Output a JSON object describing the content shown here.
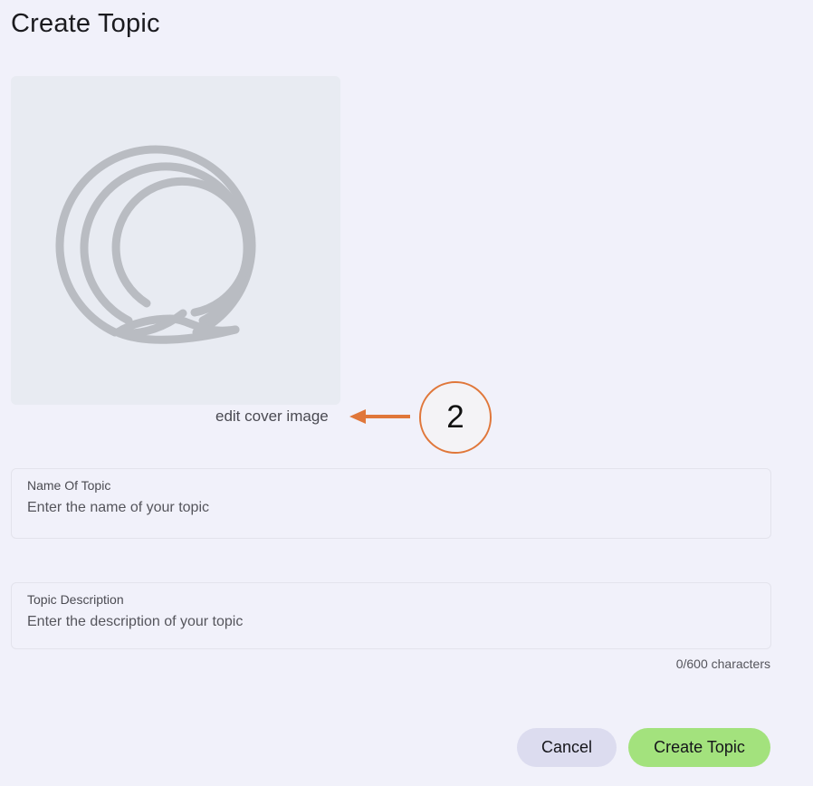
{
  "page": {
    "title": "Create Topic"
  },
  "cover": {
    "edit_label": "edit cover image",
    "placeholder_icon": "logo-ring-icon"
  },
  "annotation": {
    "number": "2",
    "color": "#e0773a"
  },
  "form": {
    "name_field": {
      "label": "Name Of Topic",
      "placeholder": "Enter the name of your topic",
      "value": ""
    },
    "description_field": {
      "label": "Topic Description",
      "placeholder": "Enter the description of your topic",
      "value": ""
    },
    "char_count": "0/600 characters"
  },
  "actions": {
    "cancel_label": "Cancel",
    "create_label": "Create Topic"
  },
  "colors": {
    "background": "#f1f1fa",
    "cancel_button": "#dcdcef",
    "create_button": "#a3e27d"
  }
}
